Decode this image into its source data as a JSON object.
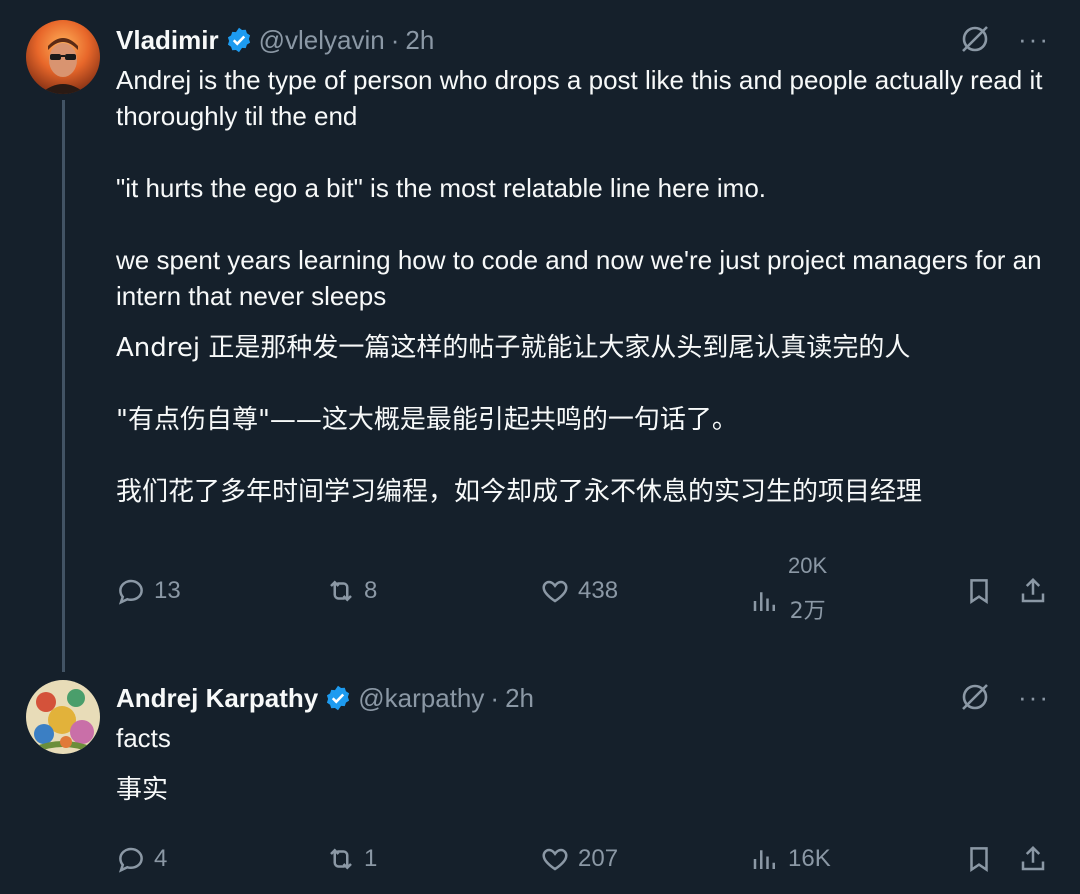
{
  "tweets": [
    {
      "name": "Vladimir",
      "handle": "@vlelyavin",
      "separator": "·",
      "time": "2h",
      "body_en": [
        "Andrej is the type of person who drops a post like this and people actually read it thoroughly til the end",
        "\"it hurts the ego a bit\" is the most relatable line here imo.",
        "we spent years learning how to code and now we're just project managers for an intern that never sleeps"
      ],
      "body_cn": [
        "Andrej 正是那种发一篇这样的帖子就能让大家从头到尾认真读完的人",
        "\"有点伤自尊\"——这大概是最能引起共鸣的一句话了。",
        "我们花了多年时间学习编程，如今却成了永不休息的实习生的项目经理"
      ],
      "replies": "13",
      "reposts": "8",
      "likes": "438",
      "views": "20K",
      "views_cn": "2万"
    },
    {
      "name": "Andrej Karpathy",
      "handle": "@karpathy",
      "separator": "·",
      "time": "2h",
      "body_en": [
        "facts"
      ],
      "body_cn": [
        "事实"
      ],
      "replies": "4",
      "reposts": "1",
      "likes": "207",
      "views": "16K"
    }
  ],
  "more_label": "···",
  "colors": {
    "background": "#15202b",
    "text": "#f7f9f9",
    "muted": "#8b98a5",
    "verified": "#1d9bf0",
    "thread_line": "#425364"
  },
  "icons": [
    "verified-badge-icon",
    "grok-icon",
    "more-icon",
    "reply-icon",
    "repost-icon",
    "like-icon",
    "views-icon",
    "bookmark-icon",
    "share-icon"
  ]
}
